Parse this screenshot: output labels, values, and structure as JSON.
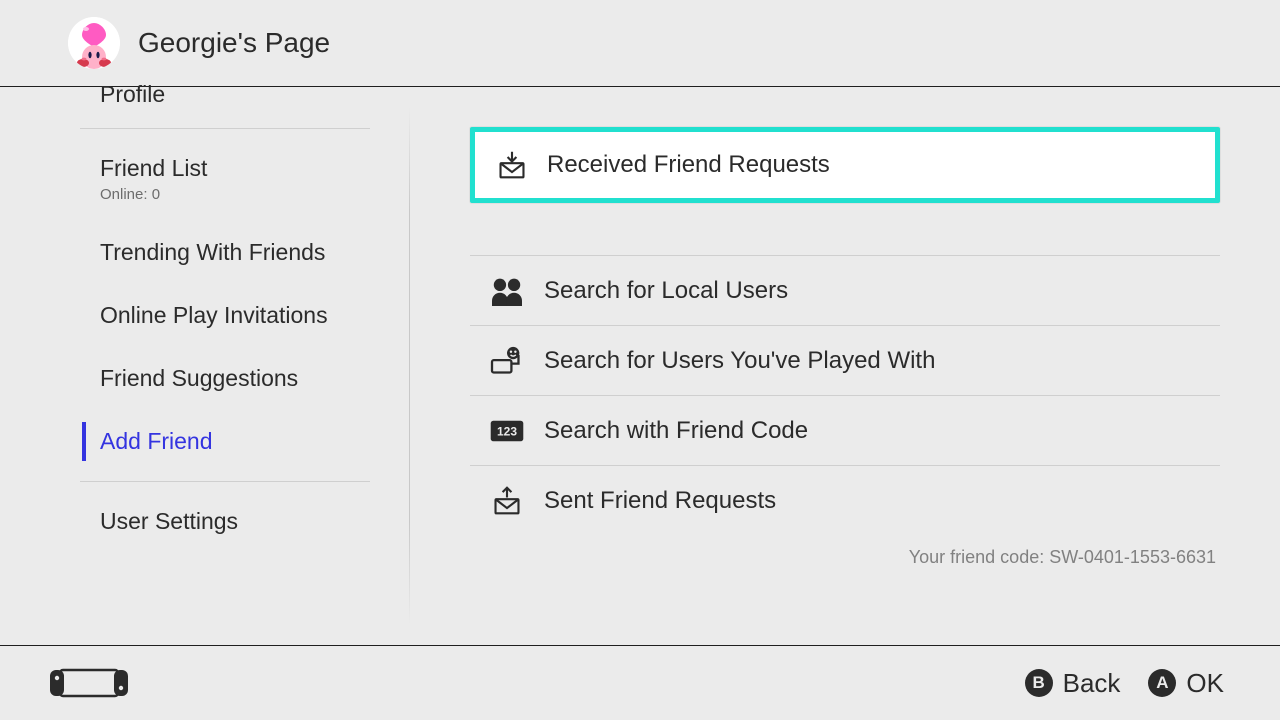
{
  "header": {
    "title": "Georgie's Page"
  },
  "sidebar": {
    "items": [
      {
        "label": "Profile"
      },
      {
        "label": "Friend List",
        "sub_prefix": "Online: ",
        "sub_count": "0"
      },
      {
        "label": "Trending With Friends"
      },
      {
        "label": "Online Play Invitations"
      },
      {
        "label": "Friend Suggestions"
      },
      {
        "label": "Add Friend",
        "selected": true
      },
      {
        "label": "User Settings"
      }
    ]
  },
  "main": {
    "received": "Received Friend Requests",
    "rows": [
      {
        "label": "Search for Local Users"
      },
      {
        "label": "Search for Users You've Played With"
      },
      {
        "label": "Search with Friend Code"
      },
      {
        "label": "Sent Friend Requests"
      }
    ],
    "friend_code_label": "Your friend code: ",
    "friend_code_value": "SW-0401-1553-6631"
  },
  "footer": {
    "back": "Back",
    "ok": "OK"
  }
}
